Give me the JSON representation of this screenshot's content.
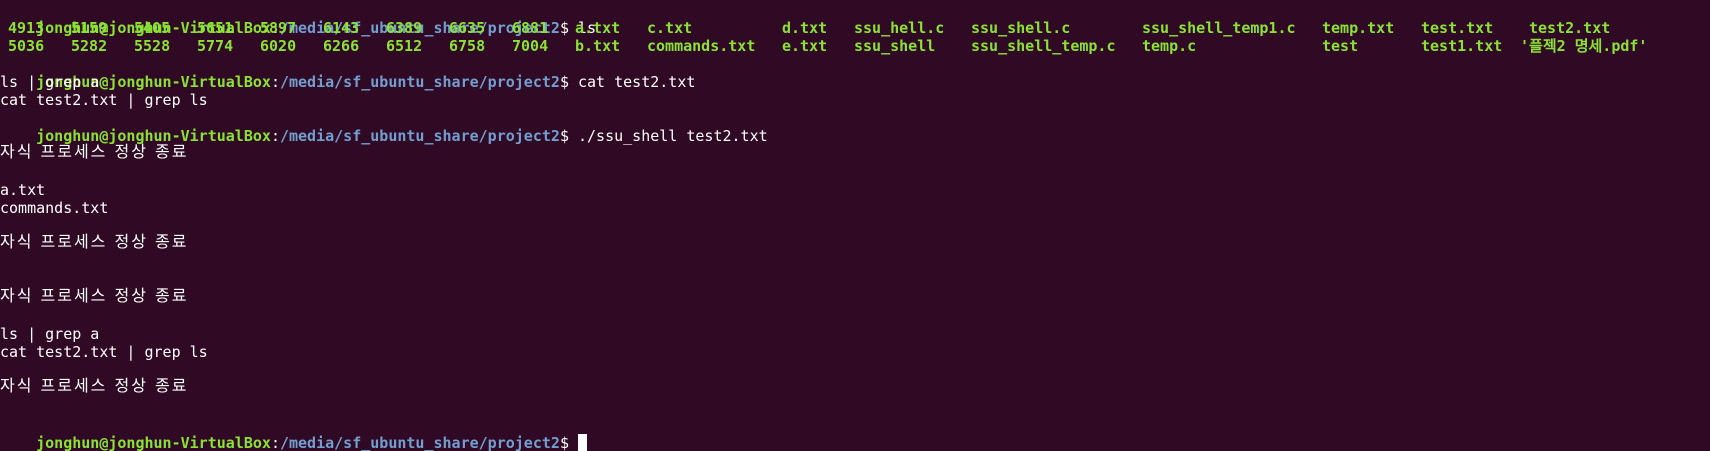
{
  "prompt": {
    "user": "jonghun@jonghun-VirtualBox",
    "colon": ":",
    "path": "/media/sf_ubuntu_share/project2",
    "dollar": "$ "
  },
  "commands": {
    "ls": "ls",
    "cat": "cat test2.txt",
    "run": "./ssu_shell test2.txt"
  },
  "ls_output": {
    "row1": [
      "4913",
      "5159",
      "5405",
      "5651",
      "5897",
      "6143",
      "6389",
      "6635",
      "6881",
      "a.txt",
      "c.txt",
      "d.txt",
      "ssu_hell.c",
      "ssu_shell.c",
      "ssu_shell_temp1.c",
      "temp.txt",
      "test.txt",
      "test2.txt"
    ],
    "row2": [
      "5036",
      "5282",
      "5528",
      "5774",
      "6020",
      "6266",
      "6512",
      "6758",
      "7004",
      "b.txt",
      "commands.txt",
      "e.txt",
      "ssu_shell",
      "ssu_shell_temp.c",
      "temp.c",
      "test",
      "test1.txt",
      "'플젝2 명세.pdf'"
    ]
  },
  "cat_output": [
    "ls | grep a",
    "cat test2.txt | grep ls"
  ],
  "run_output": {
    "msg1": "자식 프로세스 정상 종료",
    "files1": "a.txt",
    "files2": "commands.txt",
    "msg2": "자식 프로세스 정상 종료",
    "msg3": "자식 프로세스 정상 종료",
    "cmd1": "ls | grep a",
    "cmd2": "cat test2.txt | grep ls",
    "msg4": "자식 프로세스 정상 종료"
  },
  "colors": {
    "background": "#300a24",
    "user": "#8ae234",
    "path": "#729fcf",
    "text": "#ffffff"
  }
}
